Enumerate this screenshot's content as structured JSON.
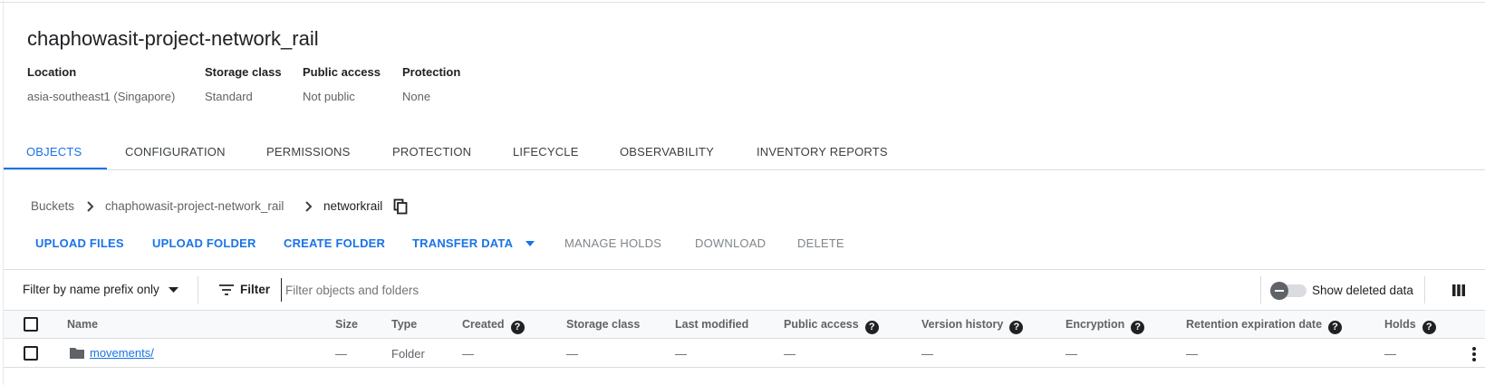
{
  "bucket": {
    "title": "chaphowasit-project-network_rail",
    "meta": [
      {
        "label": "Location",
        "value": "asia-southeast1 (Singapore)"
      },
      {
        "label": "Storage class",
        "value": "Standard"
      },
      {
        "label": "Public access",
        "value": "Not public"
      },
      {
        "label": "Protection",
        "value": "None"
      }
    ]
  },
  "tabs": [
    {
      "label": "OBJECTS",
      "active": true
    },
    {
      "label": "CONFIGURATION"
    },
    {
      "label": "PERMISSIONS"
    },
    {
      "label": "PROTECTION"
    },
    {
      "label": "LIFECYCLE"
    },
    {
      "label": "OBSERVABILITY"
    },
    {
      "label": "INVENTORY REPORTS"
    }
  ],
  "breadcrumb": {
    "items": [
      "Buckets",
      "chaphowasit-project-network_rail",
      "networkrail"
    ]
  },
  "actions": {
    "upload_files": "UPLOAD FILES",
    "upload_folder": "UPLOAD FOLDER",
    "create_folder": "CREATE FOLDER",
    "transfer_data": "TRANSFER DATA",
    "manage_holds": "MANAGE HOLDS",
    "download": "DOWNLOAD",
    "delete": "DELETE"
  },
  "filter": {
    "mode_label": "Filter by name prefix only",
    "filter_label": "Filter",
    "placeholder": "Filter objects and folders",
    "show_deleted_label": "Show deleted data",
    "show_deleted_on": false
  },
  "table": {
    "columns": [
      {
        "label": "Name",
        "help": false
      },
      {
        "label": "Size",
        "help": false
      },
      {
        "label": "Type",
        "help": false
      },
      {
        "label": "Created",
        "help": true
      },
      {
        "label": "Storage class",
        "help": false
      },
      {
        "label": "Last modified",
        "help": false
      },
      {
        "label": "Public access",
        "help": true
      },
      {
        "label": "Version history",
        "help": true
      },
      {
        "label": "Encryption",
        "help": true
      },
      {
        "label": "Retention expiration date",
        "help": true
      },
      {
        "label": "Holds",
        "help": true
      }
    ],
    "rows": [
      {
        "name": "movements/",
        "icon": "folder-icon",
        "cells": [
          "—",
          "Folder",
          "—",
          "—",
          "—",
          "—",
          "—",
          "—",
          "—",
          "—"
        ]
      }
    ]
  },
  "colors": {
    "accent": "#1a73e8",
    "text": "#202124",
    "muted": "#5f6368"
  }
}
